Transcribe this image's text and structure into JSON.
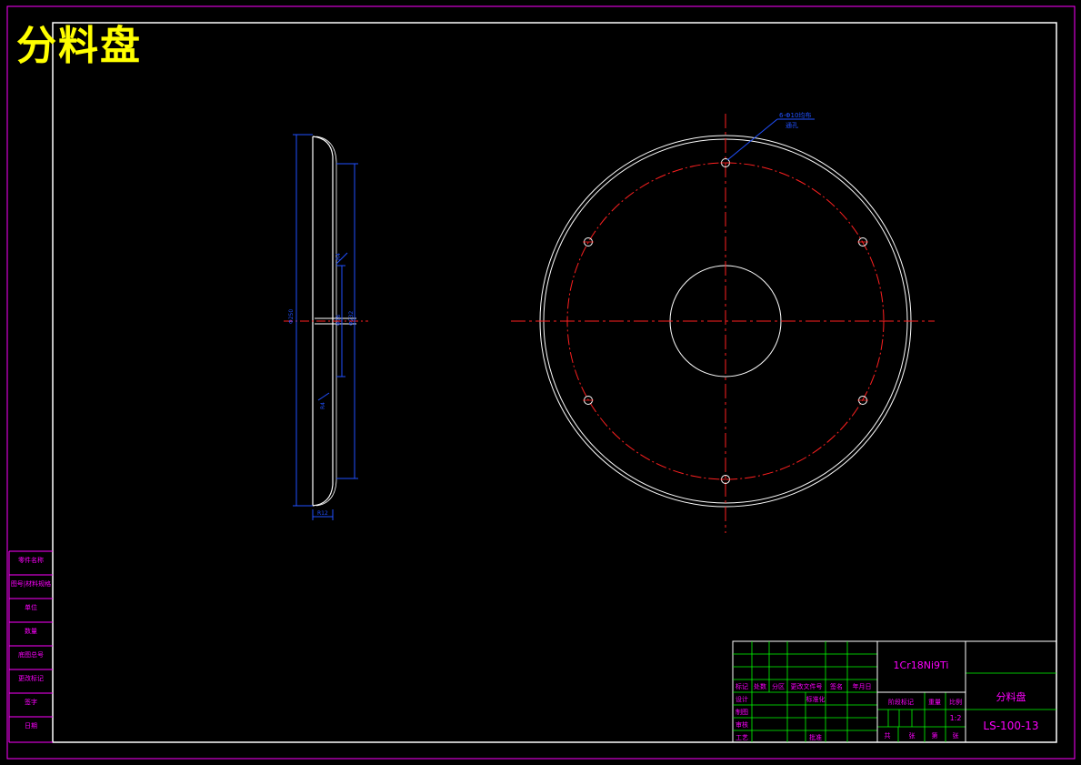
{
  "title": "分料盘",
  "material": "1Cr18Ni9Ti",
  "part_name": "分料盘",
  "drawing_number": "LS-100-13",
  "scale": "1:2",
  "hole_note_line1": "6-Φ10均布",
  "hole_note_line2": "通孔",
  "side_labels": [
    "零件名称",
    "图号|材料规格",
    "单位",
    "数量",
    "底图总号",
    "更改标记",
    "签字",
    "日期"
  ],
  "tb_row_labels": [
    "标记",
    "处数",
    "分区",
    "更改文件号",
    "签名",
    "年月日"
  ],
  "tb_left_col": [
    "设计",
    "制图",
    "审核",
    "工艺"
  ],
  "tb_mid_labels": [
    "标准化",
    "批准"
  ],
  "tb_right_labels": [
    "阶段标记",
    "重量",
    "比例"
  ],
  "tb_bottom_labels": [
    "共",
    "张",
    "第",
    "张"
  ]
}
